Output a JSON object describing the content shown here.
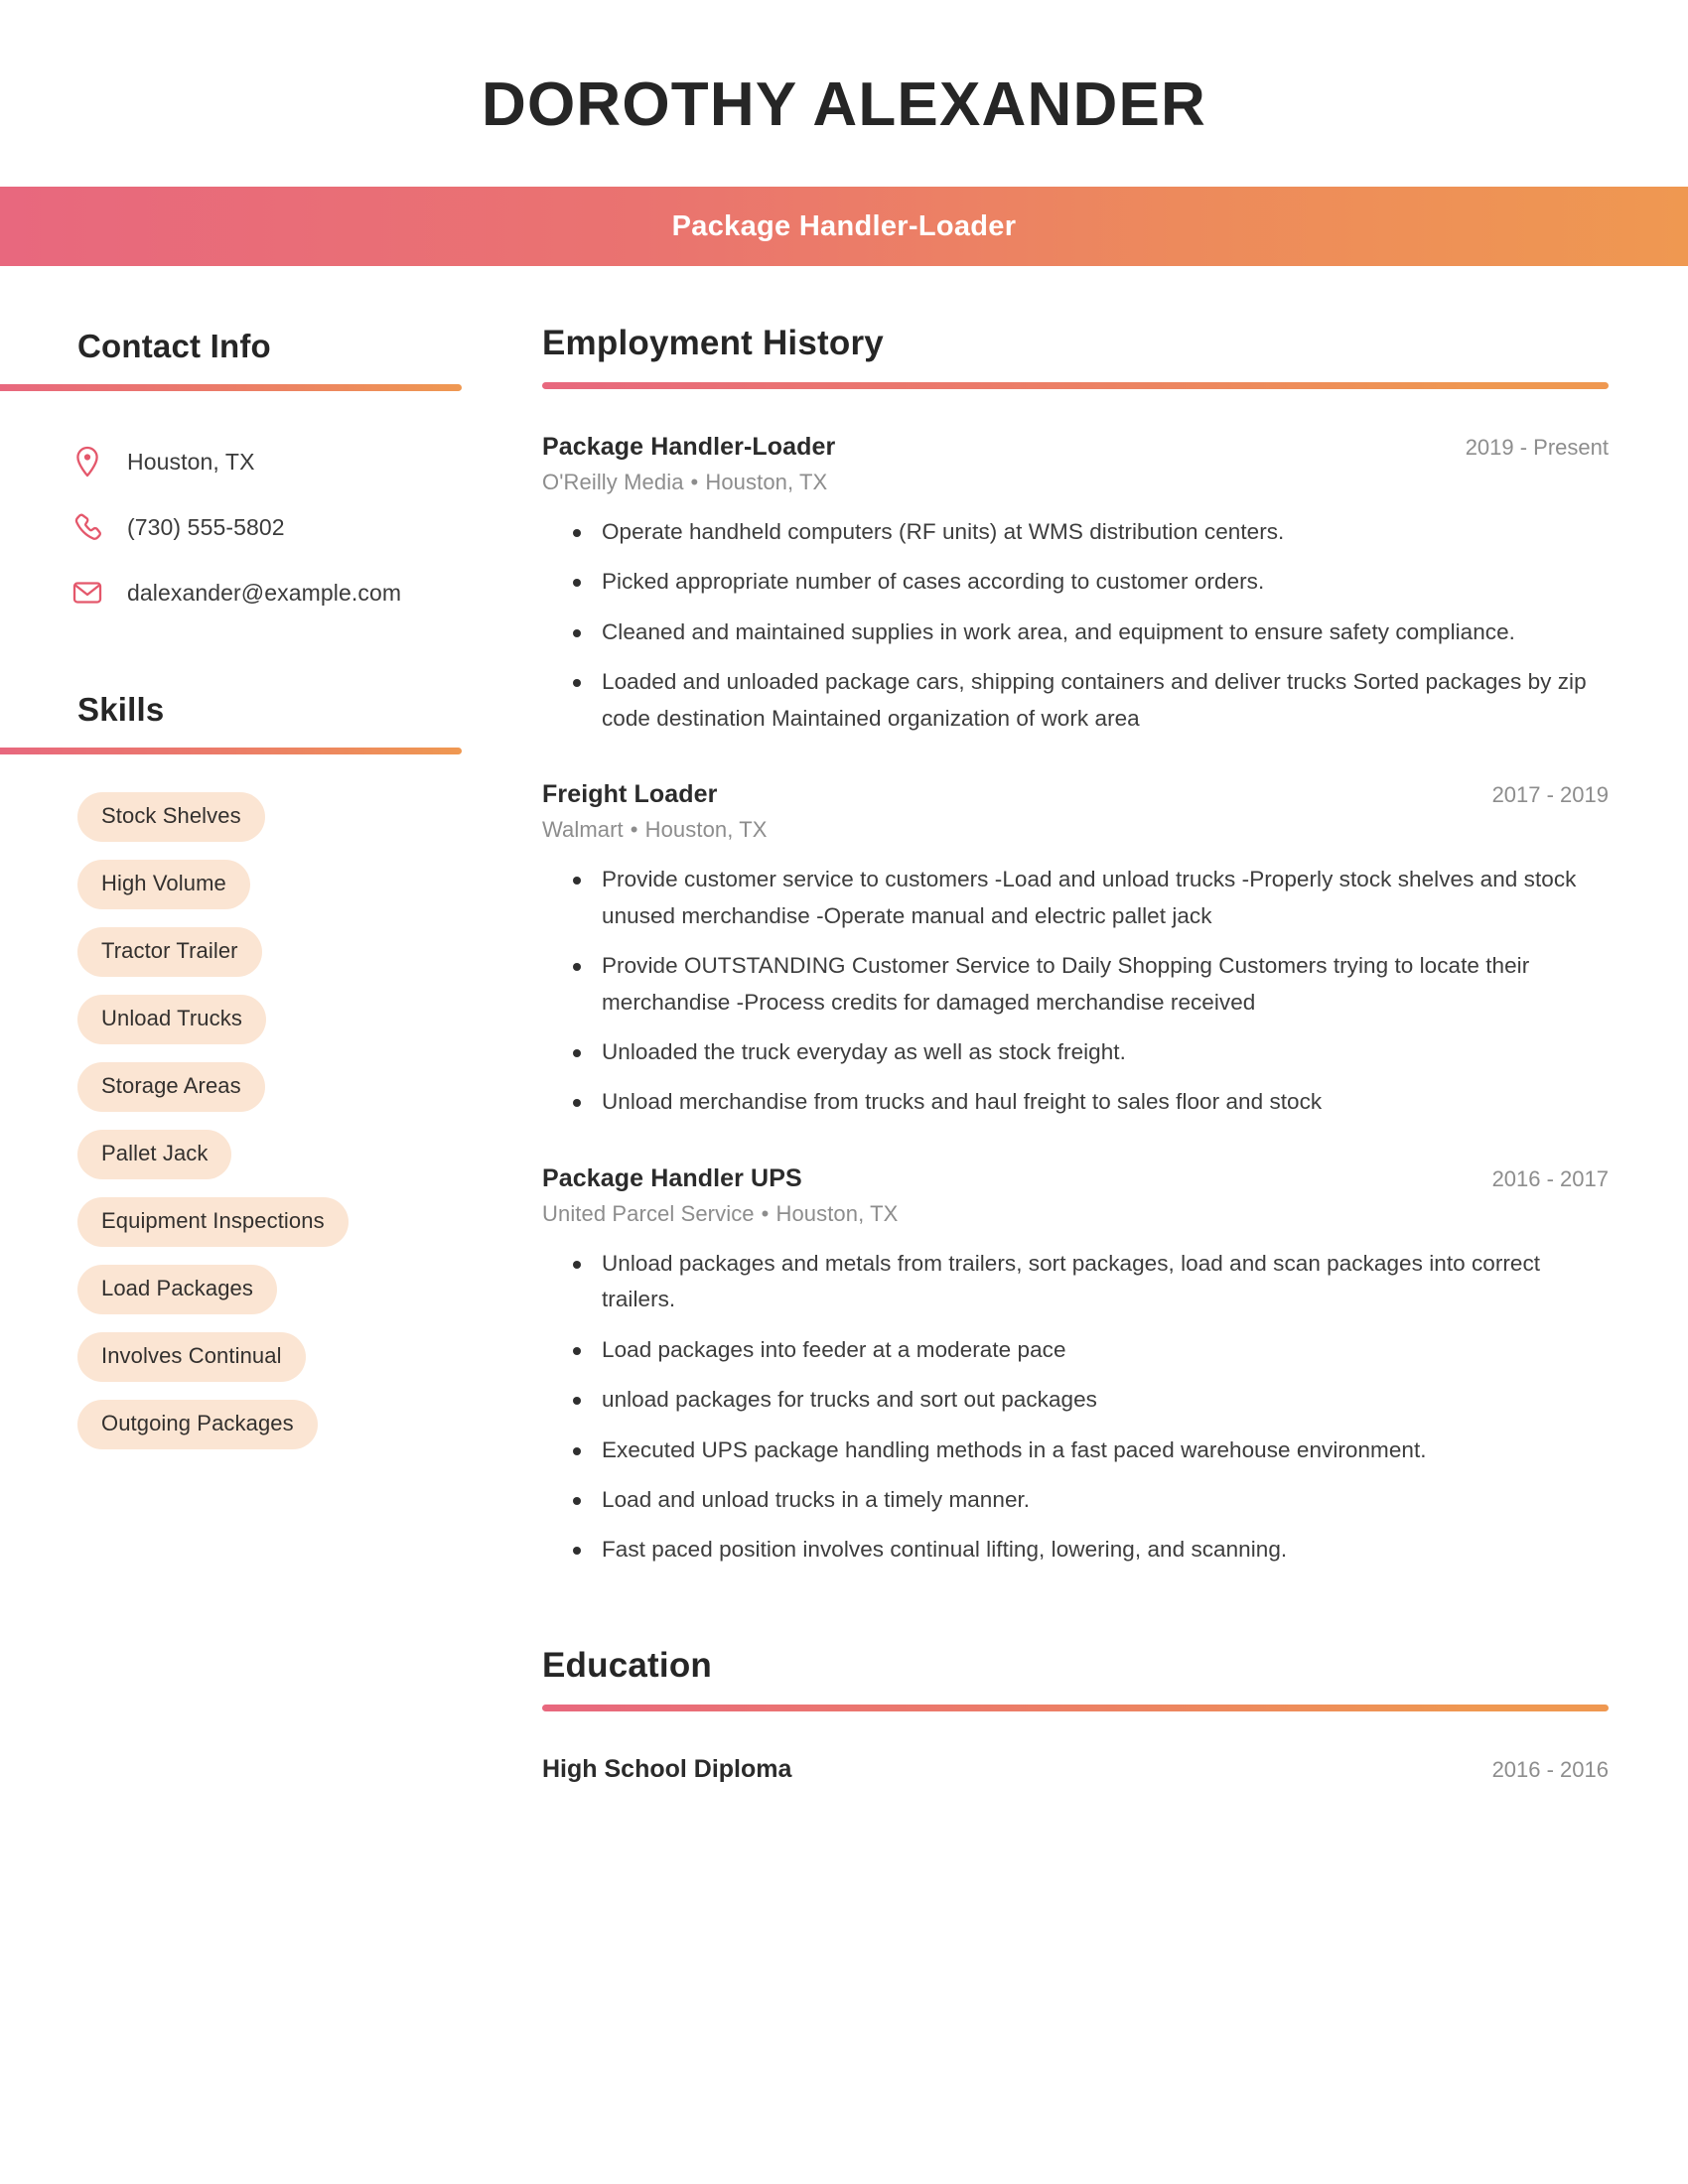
{
  "theme": {
    "gradient_start": "#e8687e",
    "gradient_end": "#ef9851",
    "icon_color": "#e4576b",
    "pill_background": "#fbe5d3",
    "heading_color": "#262626",
    "muted_text": "#8d8d8d",
    "body_text": "#3d3d3d"
  },
  "header": {
    "name": "DOROTHY ALEXANDER",
    "job_title_banner": "Package Handler-Loader"
  },
  "sidebar": {
    "contact": {
      "heading": "Contact Info",
      "items": [
        {
          "icon": "map-pin-icon",
          "value": "Houston, TX"
        },
        {
          "icon": "phone-icon",
          "value": "(730) 555-5802"
        },
        {
          "icon": "envelope-icon",
          "value": "dalexander@example.com"
        }
      ]
    },
    "skills": {
      "heading": "Skills",
      "items": [
        "Stock Shelves",
        "High Volume",
        "Tractor Trailer",
        "Unload Trucks",
        "Storage Areas",
        "Pallet Jack",
        "Equipment Inspections",
        "Load Packages",
        "Involves Continual",
        "Outgoing Packages"
      ]
    }
  },
  "main": {
    "employment": {
      "heading": "Employment History",
      "jobs": [
        {
          "title": "Package Handler-Loader",
          "dates": "2019 - Present",
          "company": "O'Reilly Media",
          "location": "Houston, TX",
          "bullets": [
            "Operate handheld computers (RF units) at WMS distribution centers.",
            "Picked appropriate number of cases according to customer orders.",
            "Cleaned and maintained supplies in work area, and equipment to ensure safety compliance.",
            "Loaded and unloaded package cars, shipping containers and deliver trucks Sorted packages by zip code destination Maintained organization of work area"
          ]
        },
        {
          "title": "Freight Loader",
          "dates": "2017 - 2019",
          "company": "Walmart",
          "location": "Houston, TX",
          "bullets": [
            "Provide customer service to customers -Load and unload trucks -Properly stock shelves and stock unused merchandise -Operate manual and electric pallet jack",
            "Provide OUTSTANDING Customer Service to Daily Shopping Customers trying to locate their merchandise -Process credits for damaged merchandise received",
            "Unloaded the truck everyday as well as stock freight.",
            "Unload merchandise from trucks and haul freight to sales floor and stock"
          ]
        },
        {
          "title": "Package Handler UPS",
          "dates": "2016 - 2017",
          "company": "United Parcel Service",
          "location": "Houston, TX",
          "bullets": [
            "Unload packages and metals from trailers, sort packages, load and scan packages into correct trailers.",
            "Load packages into feeder at a moderate pace",
            "unload packages for trucks and sort out packages",
            "Executed UPS package handling methods in a fast paced warehouse environment.",
            "Load and unload trucks in a timely manner.",
            "Fast paced position involves continual lifting, lowering, and scanning."
          ]
        }
      ]
    },
    "education": {
      "heading": "Education",
      "items": [
        {
          "title": "High School Diploma",
          "dates": "2016 - 2016"
        }
      ]
    }
  }
}
